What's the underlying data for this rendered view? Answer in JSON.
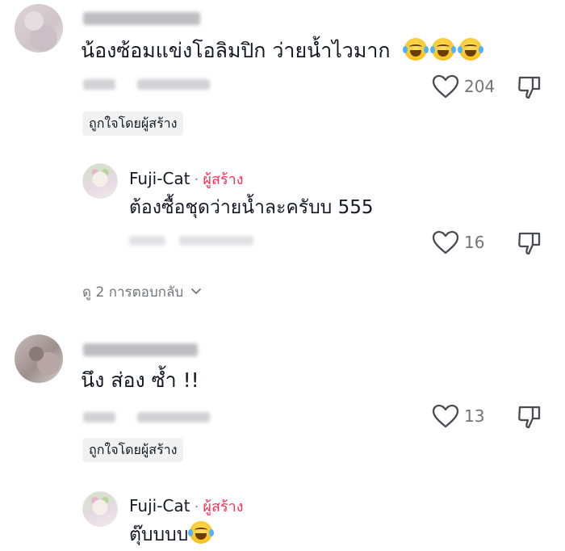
{
  "comments": [
    {
      "text": "น้องซ้อมแข่งโอลิมปิก ว่ายน้ำไวมาก",
      "emoji": [
        "face-with-tears-of-joy-icon",
        "face-with-tears-of-joy-icon",
        "face-with-tears-of-joy-icon"
      ],
      "likes": "204",
      "liked_by_creator_label": "ถูกใจโดยผู้สร้าง",
      "reply": {
        "author": "Fuji-Cat",
        "separator": "·",
        "creator_label": "ผู้สร้าง",
        "text": "ต้องซื้อชุดว่ายน้ำละครับบ 555",
        "likes": "16"
      },
      "view_replies_label": "ดู 2 การตอบกลับ"
    },
    {
      "text": "นึง ส่อง ซ้ำ !!",
      "likes": "13",
      "liked_by_creator_label": "ถูกใจโดยผู้สร้าง",
      "reply": {
        "author": "Fuji-Cat",
        "separator": "·",
        "creator_label": "ผู้สร้าง",
        "text": "ตุ๊บบบบ",
        "emoji": [
          "face-with-tears-of-joy-icon"
        ]
      }
    }
  ],
  "colors": {
    "creator_accent": "#fe2c55",
    "secondary_text": "#73747b",
    "pill_bg": "#f1f1f2"
  }
}
